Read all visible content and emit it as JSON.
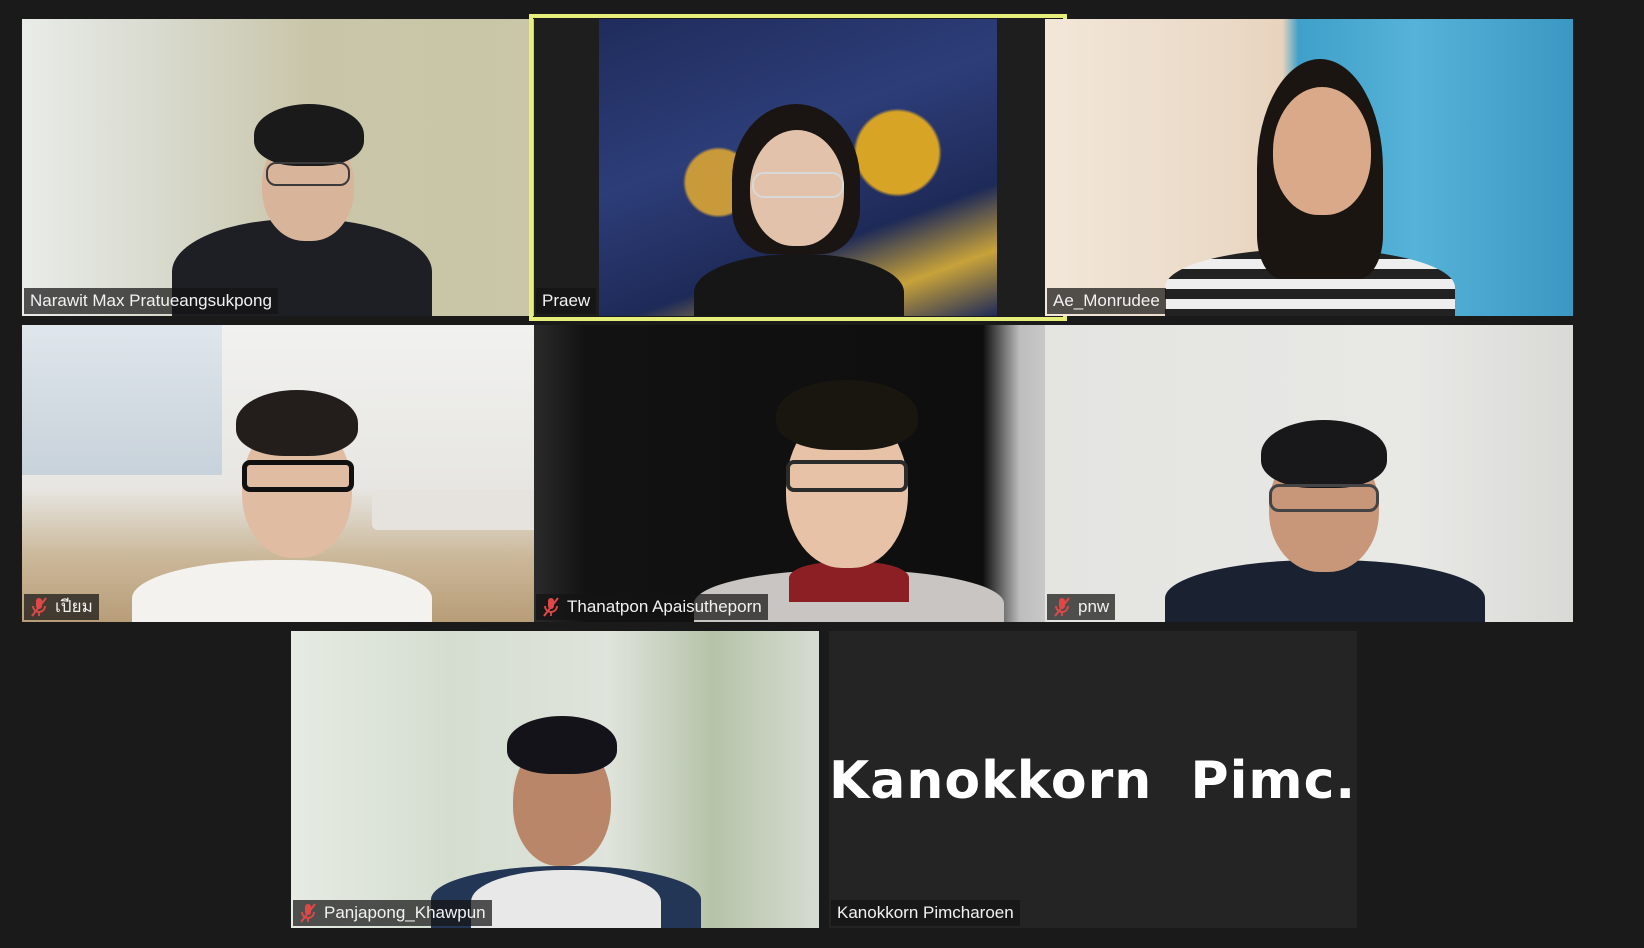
{
  "participants": [
    {
      "name": "Narawit Max Pratueangsukpong",
      "muted": false,
      "active": false,
      "video": true
    },
    {
      "name": "Praew",
      "muted": false,
      "active": true,
      "video": true
    },
    {
      "name": "Ae_Monrudee",
      "muted": false,
      "active": false,
      "video": true
    },
    {
      "name": "เปียม",
      "muted": true,
      "active": false,
      "video": true
    },
    {
      "name": "Thanatpon Apaisutheporn",
      "muted": true,
      "active": false,
      "video": true
    },
    {
      "name": "pnw",
      "muted": true,
      "active": false,
      "video": true
    },
    {
      "name": "Panjapong_Khawpun",
      "muted": true,
      "active": false,
      "video": true
    },
    {
      "name": "Kanokkorn Pimcharoen",
      "muted": false,
      "active": false,
      "video": false,
      "display_name": "Kanokkorn  Pimc..."
    }
  ],
  "colors": {
    "background": "#1a1a1a",
    "active_speaker_border": "#e7ee7a",
    "muted_icon": "#e04848"
  },
  "icons": {
    "muted": "mic-muted-icon"
  }
}
